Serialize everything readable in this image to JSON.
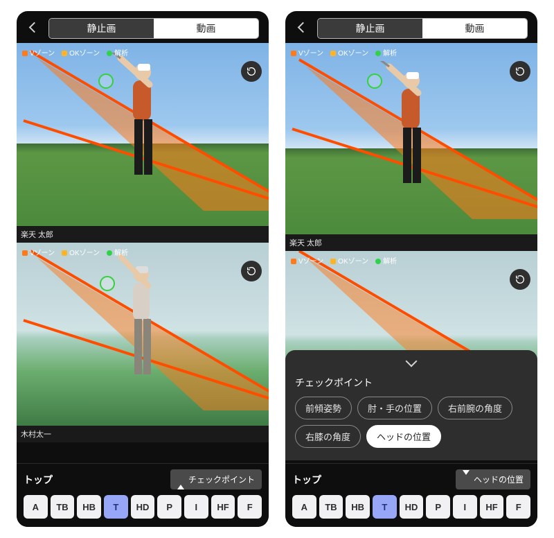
{
  "tabs": {
    "still": "静止画",
    "video": "動画"
  },
  "legend": {
    "v": {
      "label": "Vゾーン",
      "color": "#ff7a1a"
    },
    "ok": {
      "label": "OKゾーン",
      "color": "#ffb426"
    },
    "an": {
      "label": "解析",
      "color": "#2fd24a"
    }
  },
  "players": {
    "top": "楽天 太郎",
    "bottom": "木村太一"
  },
  "footer": {
    "title": "トップ",
    "btn_closed": "チェックポイント",
    "btn_open": "ヘッドの位置"
  },
  "phases": [
    "A",
    "TB",
    "HB",
    "T",
    "HD",
    "P",
    "I",
    "HF",
    "F"
  ],
  "phase_active": "T",
  "drawer": {
    "title": "チェックポイント",
    "chips": [
      "前傾姿勢",
      "肘・手の位置",
      "右前腕の角度",
      "右膝の角度",
      "ヘッドの位置"
    ],
    "selected": "ヘッドの位置"
  }
}
